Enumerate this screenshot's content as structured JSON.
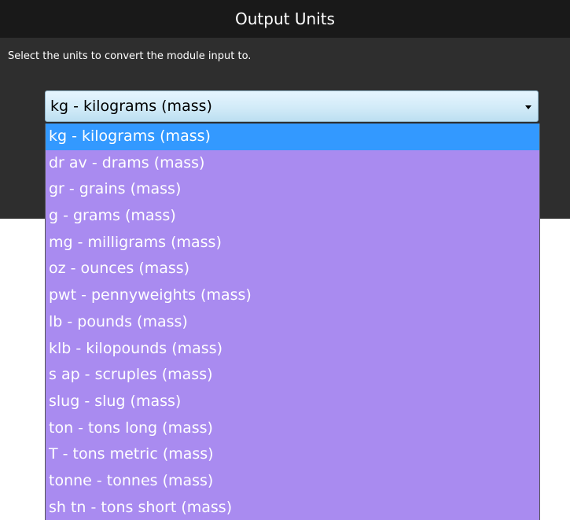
{
  "panel": {
    "title": "Output Units",
    "description": "Select the units to convert the module input to."
  },
  "select": {
    "value": "kg - kilograms (mass)"
  },
  "options": [
    {
      "label": "kg - kilograms (mass)",
      "selected": true
    },
    {
      "label": "dr av - drams (mass)",
      "selected": false
    },
    {
      "label": "gr - grains (mass)",
      "selected": false
    },
    {
      "label": "g - grams (mass)",
      "selected": false
    },
    {
      "label": "mg - milligrams (mass)",
      "selected": false
    },
    {
      "label": "oz - ounces (mass)",
      "selected": false
    },
    {
      "label": "pwt - pennyweights (mass)",
      "selected": false
    },
    {
      "label": "lb - pounds (mass)",
      "selected": false
    },
    {
      "label": "klb - kilopounds (mass)",
      "selected": false
    },
    {
      "label": "s ap - scruples (mass)",
      "selected": false
    },
    {
      "label": "slug - slug (mass)",
      "selected": false
    },
    {
      "label": "ton - tons long (mass)",
      "selected": false
    },
    {
      "label": "T - tons metric (mass)",
      "selected": false
    },
    {
      "label": "tonne - tonnes (mass)",
      "selected": false
    },
    {
      "label": "sh tn - tons short (mass)",
      "selected": false
    }
  ],
  "colors": {
    "panel_bg": "#2e2e2e",
    "header_bg": "#191919",
    "list_bg": "#a98bf0",
    "selected_bg": "#3399ff"
  },
  "icons": {
    "select_arrow": "triangle-down"
  }
}
